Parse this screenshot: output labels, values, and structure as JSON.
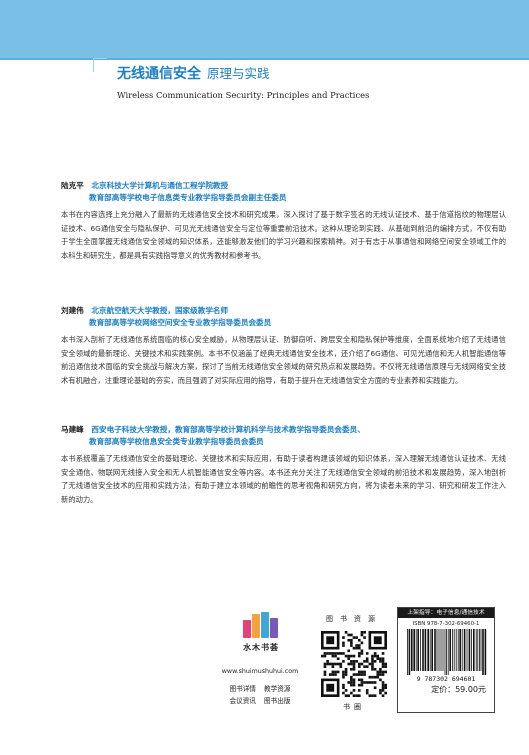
{
  "header": {
    "title_cn": "无线通信安全",
    "subtitle_cn": "原理与实践",
    "title_en": "Wireless Communication Security: Principles and Practices",
    "banner_color": "#79bfe6",
    "accent_color": "#1d7fc4"
  },
  "reviews": [
    {
      "name": "陆克平",
      "title_line1": "北京科技大学计算机与通信工程学院教授",
      "title_line2": "教育部高等学校电子信息类专业教学指导委员会副主任委员",
      "text": "本书在内容选择上充分融入了最新的无线通信安全技术和研究成果，深入探讨了基于数字签名的无线认证技术、基于信道指纹的物理层认证技术、6G通信安全与隐私保护、可见光无线通信安全与定位等重要前沿技术。这种从理论到实践、从基础到前沿的编排方式，不仅有助于学生全面掌握无线通信安全领域的知识体系，还能够激发他们的学习兴趣和探索精神。对于有志于从事通信和网络空间安全领域工作的本科生和研究生，都是具有实践指导意义的优秀教材和参考书。"
    },
    {
      "name": "刘建伟",
      "title_line1": "北京航空航天大学教授，国家级教学名师",
      "title_line2": "教育部高等学校网络空间安全专业教学指导委员会委员",
      "text": "本书深入剖析了无线通信系统面临的核心安全威胁，从物理层认证、防御窃听、跨层安全和隐私保护等维度，全面系统地介绍了无线通信安全领域的最新理论、关键技术和实践案例。本书不仅涵盖了经典无线通信安全技术，还介绍了6G通信、可见光通信和无人机智能通信等前沿通信技术面临的安全挑战与解决方案，探讨了当前无线通信安全领域的研究热点和发展趋势。不仅将无线通信原理与无线网络安全技术有机融合，注重理论基础的夯实，而且强调了对实际应用的指导，有助于提升在无线通信安全方面的专业素养和实践能力。"
    },
    {
      "name": "马建峰",
      "title_line1": "西安电子科技大学教授，教育部高等学校计算机科学与技术教学指导委员会委员、",
      "title_line2": "教育部高等学校信息安全类专业教学指导委员会委员",
      "text": "本书系统覆盖了无线通信安全的基础理论、关键技术和实际应用，有助于读者构建该领域的知识体系，深入理解无线通信认证技术、无线安全通信、物联网无线接入安全和无人机智能通信安全等内容。本书还充分关注了无线通信安全领域的前沿技术和发展趋势，深入地剖析了无线通信安全技术的应用和实践方法，有助于建立本领域的前瞻性的思考视角和研究方向，将为读者未来的学习、研究和研发工作注入新的动力。"
    }
  ],
  "publisher": {
    "logo_name": "水木书荟",
    "website": "www.shuimushuhui.com",
    "links": [
      "图书详情",
      "教学资源",
      "会议资讯",
      "图书出版"
    ]
  },
  "qr": {
    "label_top": "图书资源",
    "label_bottom": "书圈"
  },
  "price_box": {
    "category": "上架指导：电子信息/通信技术",
    "isbn": "ISBN 978-7-302-69460-1",
    "barcode_digits": "9 787302 694601",
    "price": "定价：59.00元"
  }
}
